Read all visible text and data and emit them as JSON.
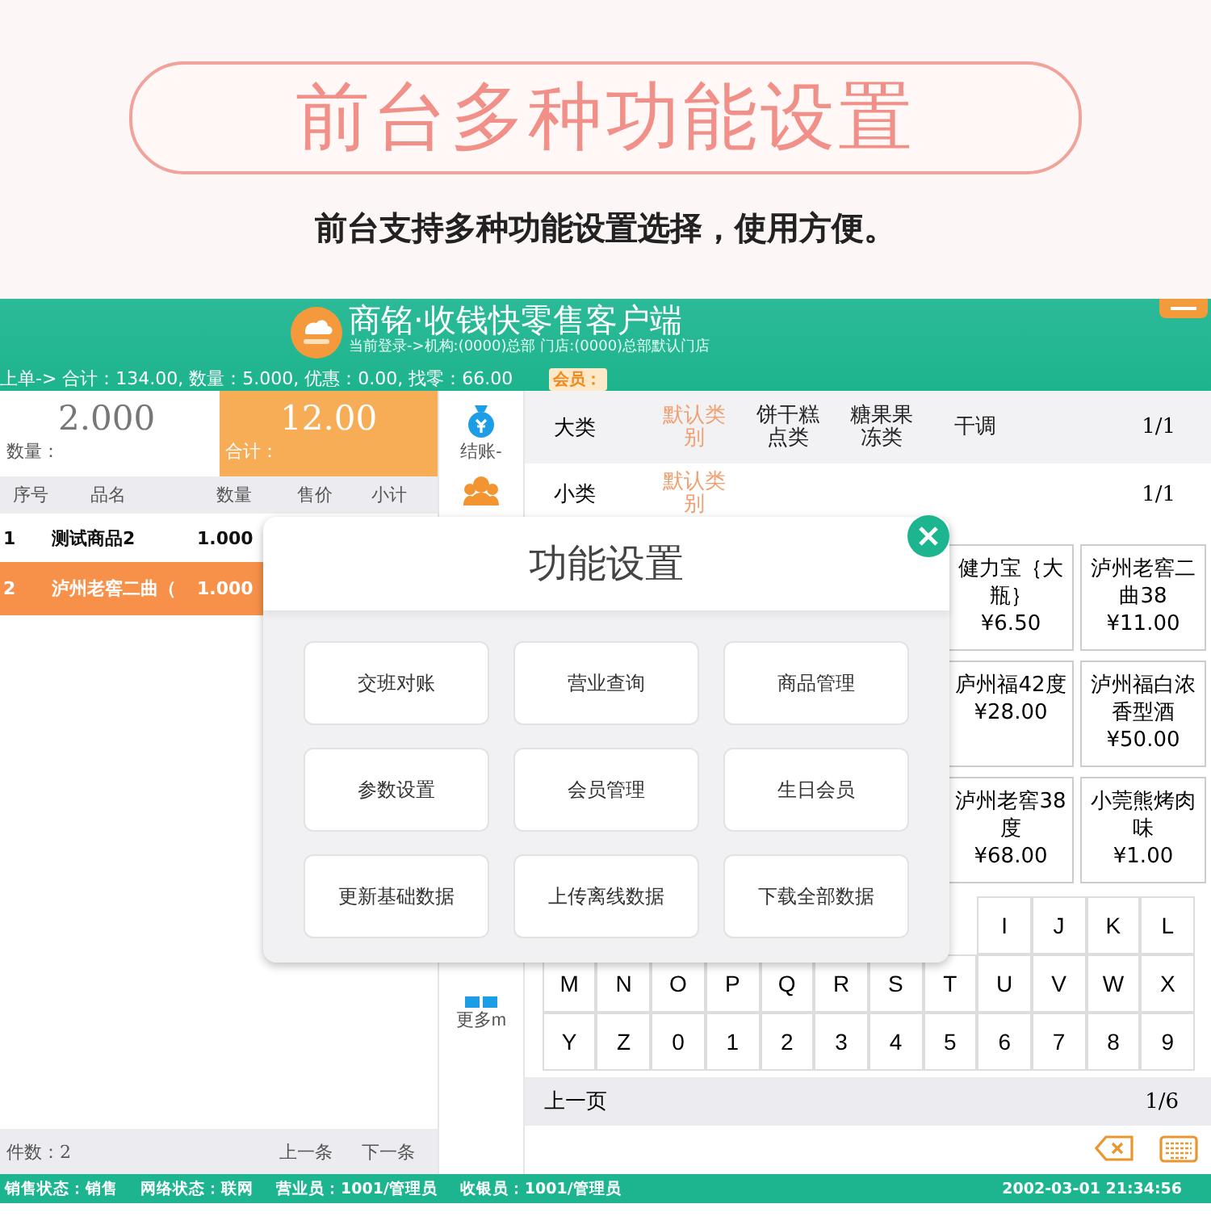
{
  "banner": {
    "title": "前台多种功能设置",
    "subtitle": "前台支持多种功能设置选择，使用方便。"
  },
  "header": {
    "app_title": "商铭·收钱快零售客户端",
    "login_info": "当前登录->机构:(0000)总部 门店:(0000)总部默认门店",
    "last_order": "上单-> 合计：134.00, 数量：5.000, 优惠：0.00, 找零：66.00",
    "member_label": "会员："
  },
  "entry": {
    "quantity": "2.000",
    "quantity_label": "数量：",
    "total": "12.00",
    "total_label": "合计："
  },
  "order_table": {
    "columns": [
      "序号",
      "品名",
      "数量",
      "售价",
      "小计"
    ],
    "rows": [
      {
        "index": "1",
        "name": "测试商品2",
        "quantity": "1.000",
        "selected": false
      },
      {
        "index": "2",
        "name": "泸州老窖二曲（",
        "quantity": "1.000",
        "selected": true
      }
    ]
  },
  "order_footer": {
    "count": "件数：2",
    "prev": "上一条",
    "next": "下一条"
  },
  "side_actions": [
    {
      "kind": "checkout",
      "label": "结账-"
    },
    {
      "kind": "member"
    },
    {
      "kind": "more",
      "label": "更多m"
    }
  ],
  "categories": {
    "label": "大类",
    "page": "1/1",
    "items": [
      {
        "label": "默认类别",
        "selected": true
      },
      {
        "label": "饼干糕点类",
        "selected": false
      },
      {
        "label": "糖果果冻类",
        "selected": false
      },
      {
        "label": "干调",
        "selected": false
      }
    ]
  },
  "subcategories": {
    "label": "小类",
    "page": "1/1",
    "items": [
      {
        "label": "默认类别",
        "selected": true
      }
    ]
  },
  "products": [
    {
      "name": "健力宝｛大瓶｝",
      "price": "¥6.50"
    },
    {
      "name": "泸州老窖二曲38",
      "price": "¥11.00"
    },
    {
      "name": "庐州福42度",
      "price": "¥28.00"
    },
    {
      "name": "泸州福白浓香型酒",
      "price": "¥50.00"
    },
    {
      "name": "泸州老窖38度",
      "price": "¥68.00"
    },
    {
      "name": "小莞熊烤肉味",
      "price": "¥1.00"
    }
  ],
  "keyboard": [
    [
      "I",
      "J",
      "K",
      "L"
    ],
    [
      "M",
      "N",
      "O",
      "P",
      "Q",
      "R",
      "S",
      "T",
      "U",
      "V",
      "W",
      "X"
    ],
    [
      "Y",
      "Z",
      "0",
      "1",
      "2",
      "3",
      "4",
      "5",
      "6",
      "7",
      "8",
      "9"
    ]
  ],
  "pager": {
    "prev": "上一页",
    "page": "1/6"
  },
  "status_bar": {
    "items": [
      "销售状态：销售",
      "网络状态：联网",
      "营业员：1001/管理员",
      "收银员：1001/管理员"
    ],
    "time": "2002-03-01 21:34:56"
  },
  "dialog": {
    "title": "功能设置",
    "buttons": [
      "交班对账",
      "营业查询",
      "商品管理",
      "参数设置",
      "会员管理",
      "生日会员",
      "更新基础数据",
      "上传离线数据",
      "下载全部数据"
    ]
  }
}
